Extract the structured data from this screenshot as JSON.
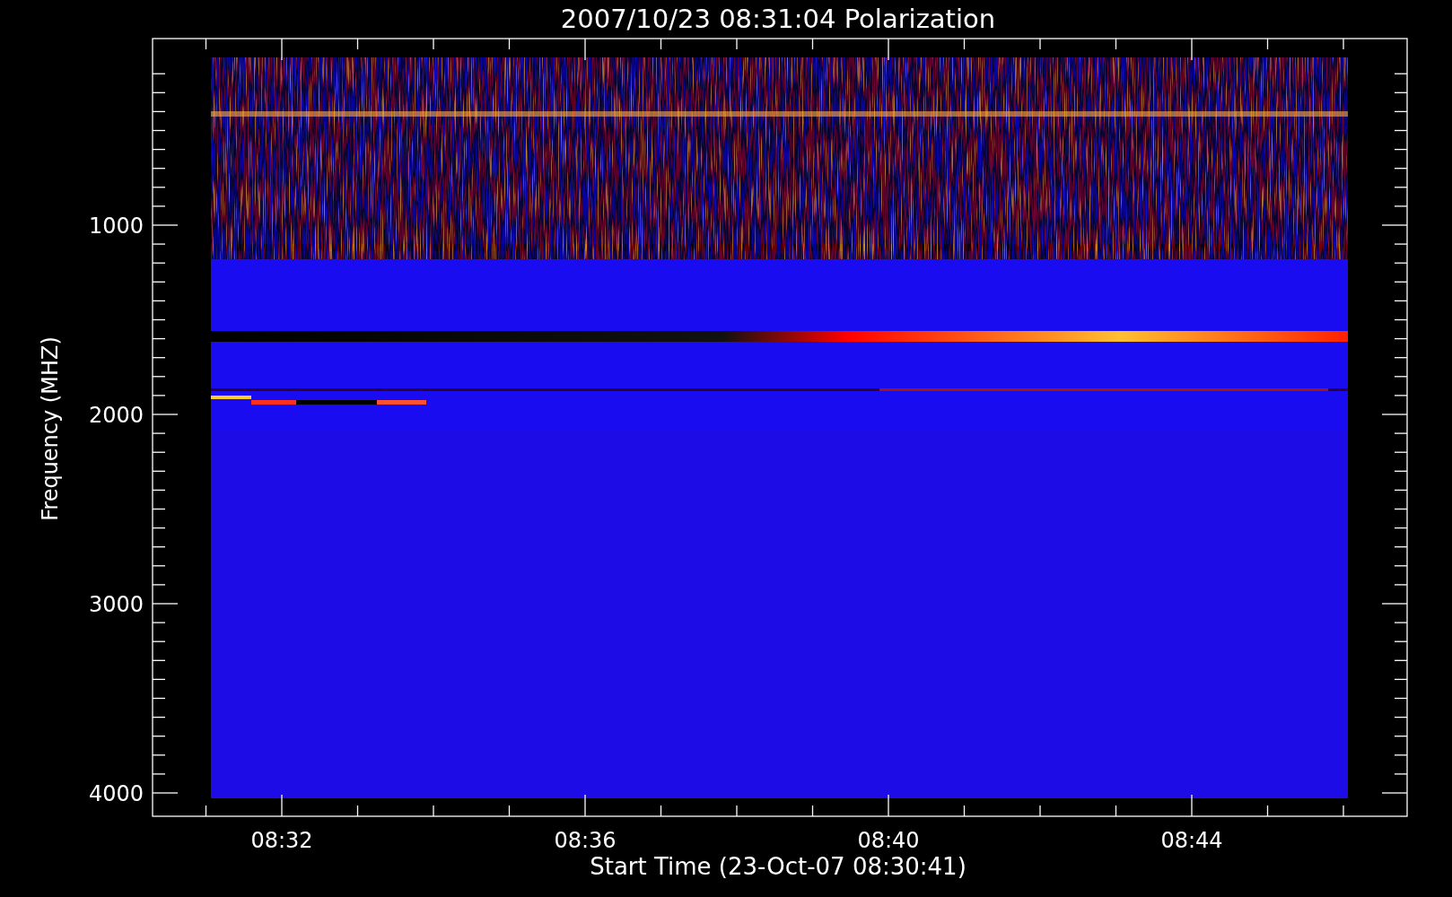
{
  "title": "2007/10/23 08:31:04 Polarization",
  "y_axis": {
    "label": "Frequency (MHZ)",
    "ticks": [
      "1000",
      "2000",
      "3000",
      "4000"
    ]
  },
  "x_axis": {
    "label": "Start Time (23-Oct-07 08:30:41)",
    "ticks": [
      "08:32",
      "08:36",
      "08:40",
      "08:44"
    ]
  }
}
